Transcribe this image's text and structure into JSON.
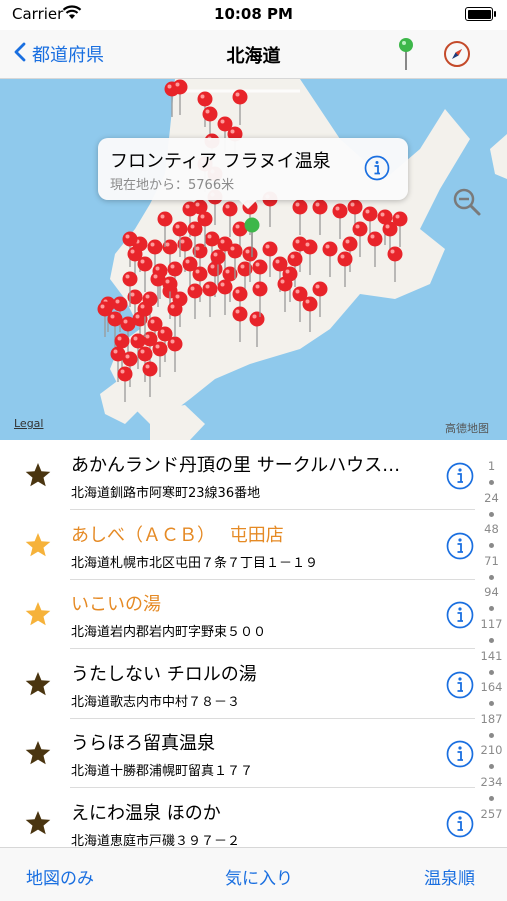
{
  "status": {
    "carrier": "Carrier",
    "time": "10:08 PM"
  },
  "nav": {
    "back_label": "都道府県",
    "title": "北海道"
  },
  "map": {
    "callout_title": "フロンティア フラヌイ温泉",
    "callout_subtitle": "現在地から：5766米",
    "legal": "Legal",
    "credit": "高德地图",
    "colors": {
      "water": "#8fc9ec",
      "land": "#f3f1ec",
      "pin": "#e8242a",
      "current_pin": "#3db74a"
    }
  },
  "list": {
    "rows": [
      {
        "name": "あかんランド丹頂の里 サークルハウス…",
        "address": "北海道釧路市阿寒町23線36番地",
        "favorite": false
      },
      {
        "name": "あしべ（ＡＣＢ）　 屯田店",
        "address": "北海道札幌市北区屯田７条７丁目１－１９",
        "favorite": true
      },
      {
        "name": "いこいの湯",
        "address": "北海道岩内郡岩内町字野束５００",
        "favorite": true
      },
      {
        "name": "うたしない チロルの湯",
        "address": "北海道歌志内市中村７８－３",
        "favorite": false
      },
      {
        "name": "うらほろ留真温泉",
        "address": "北海道十勝郡浦幌町留真１７７",
        "favorite": false
      },
      {
        "name": "えにわ温泉 ほのか",
        "address": "北海道恵庭市戸磯３９７－２",
        "favorite": false
      }
    ],
    "index": [
      "1",
      "24",
      "48",
      "71",
      "94",
      "117",
      "141",
      "164",
      "187",
      "210",
      "234",
      "257"
    ]
  },
  "toolbar": {
    "map_only": "地図のみ",
    "favorites": "気に入り",
    "onsen_order": "温泉順"
  },
  "icons": {
    "back": "chevron-left-icon",
    "pin": "map-pin-icon",
    "compass": "compass-icon",
    "info": "info-circle-icon",
    "star": "star-icon",
    "zoom": "zoom-out-icon"
  }
}
